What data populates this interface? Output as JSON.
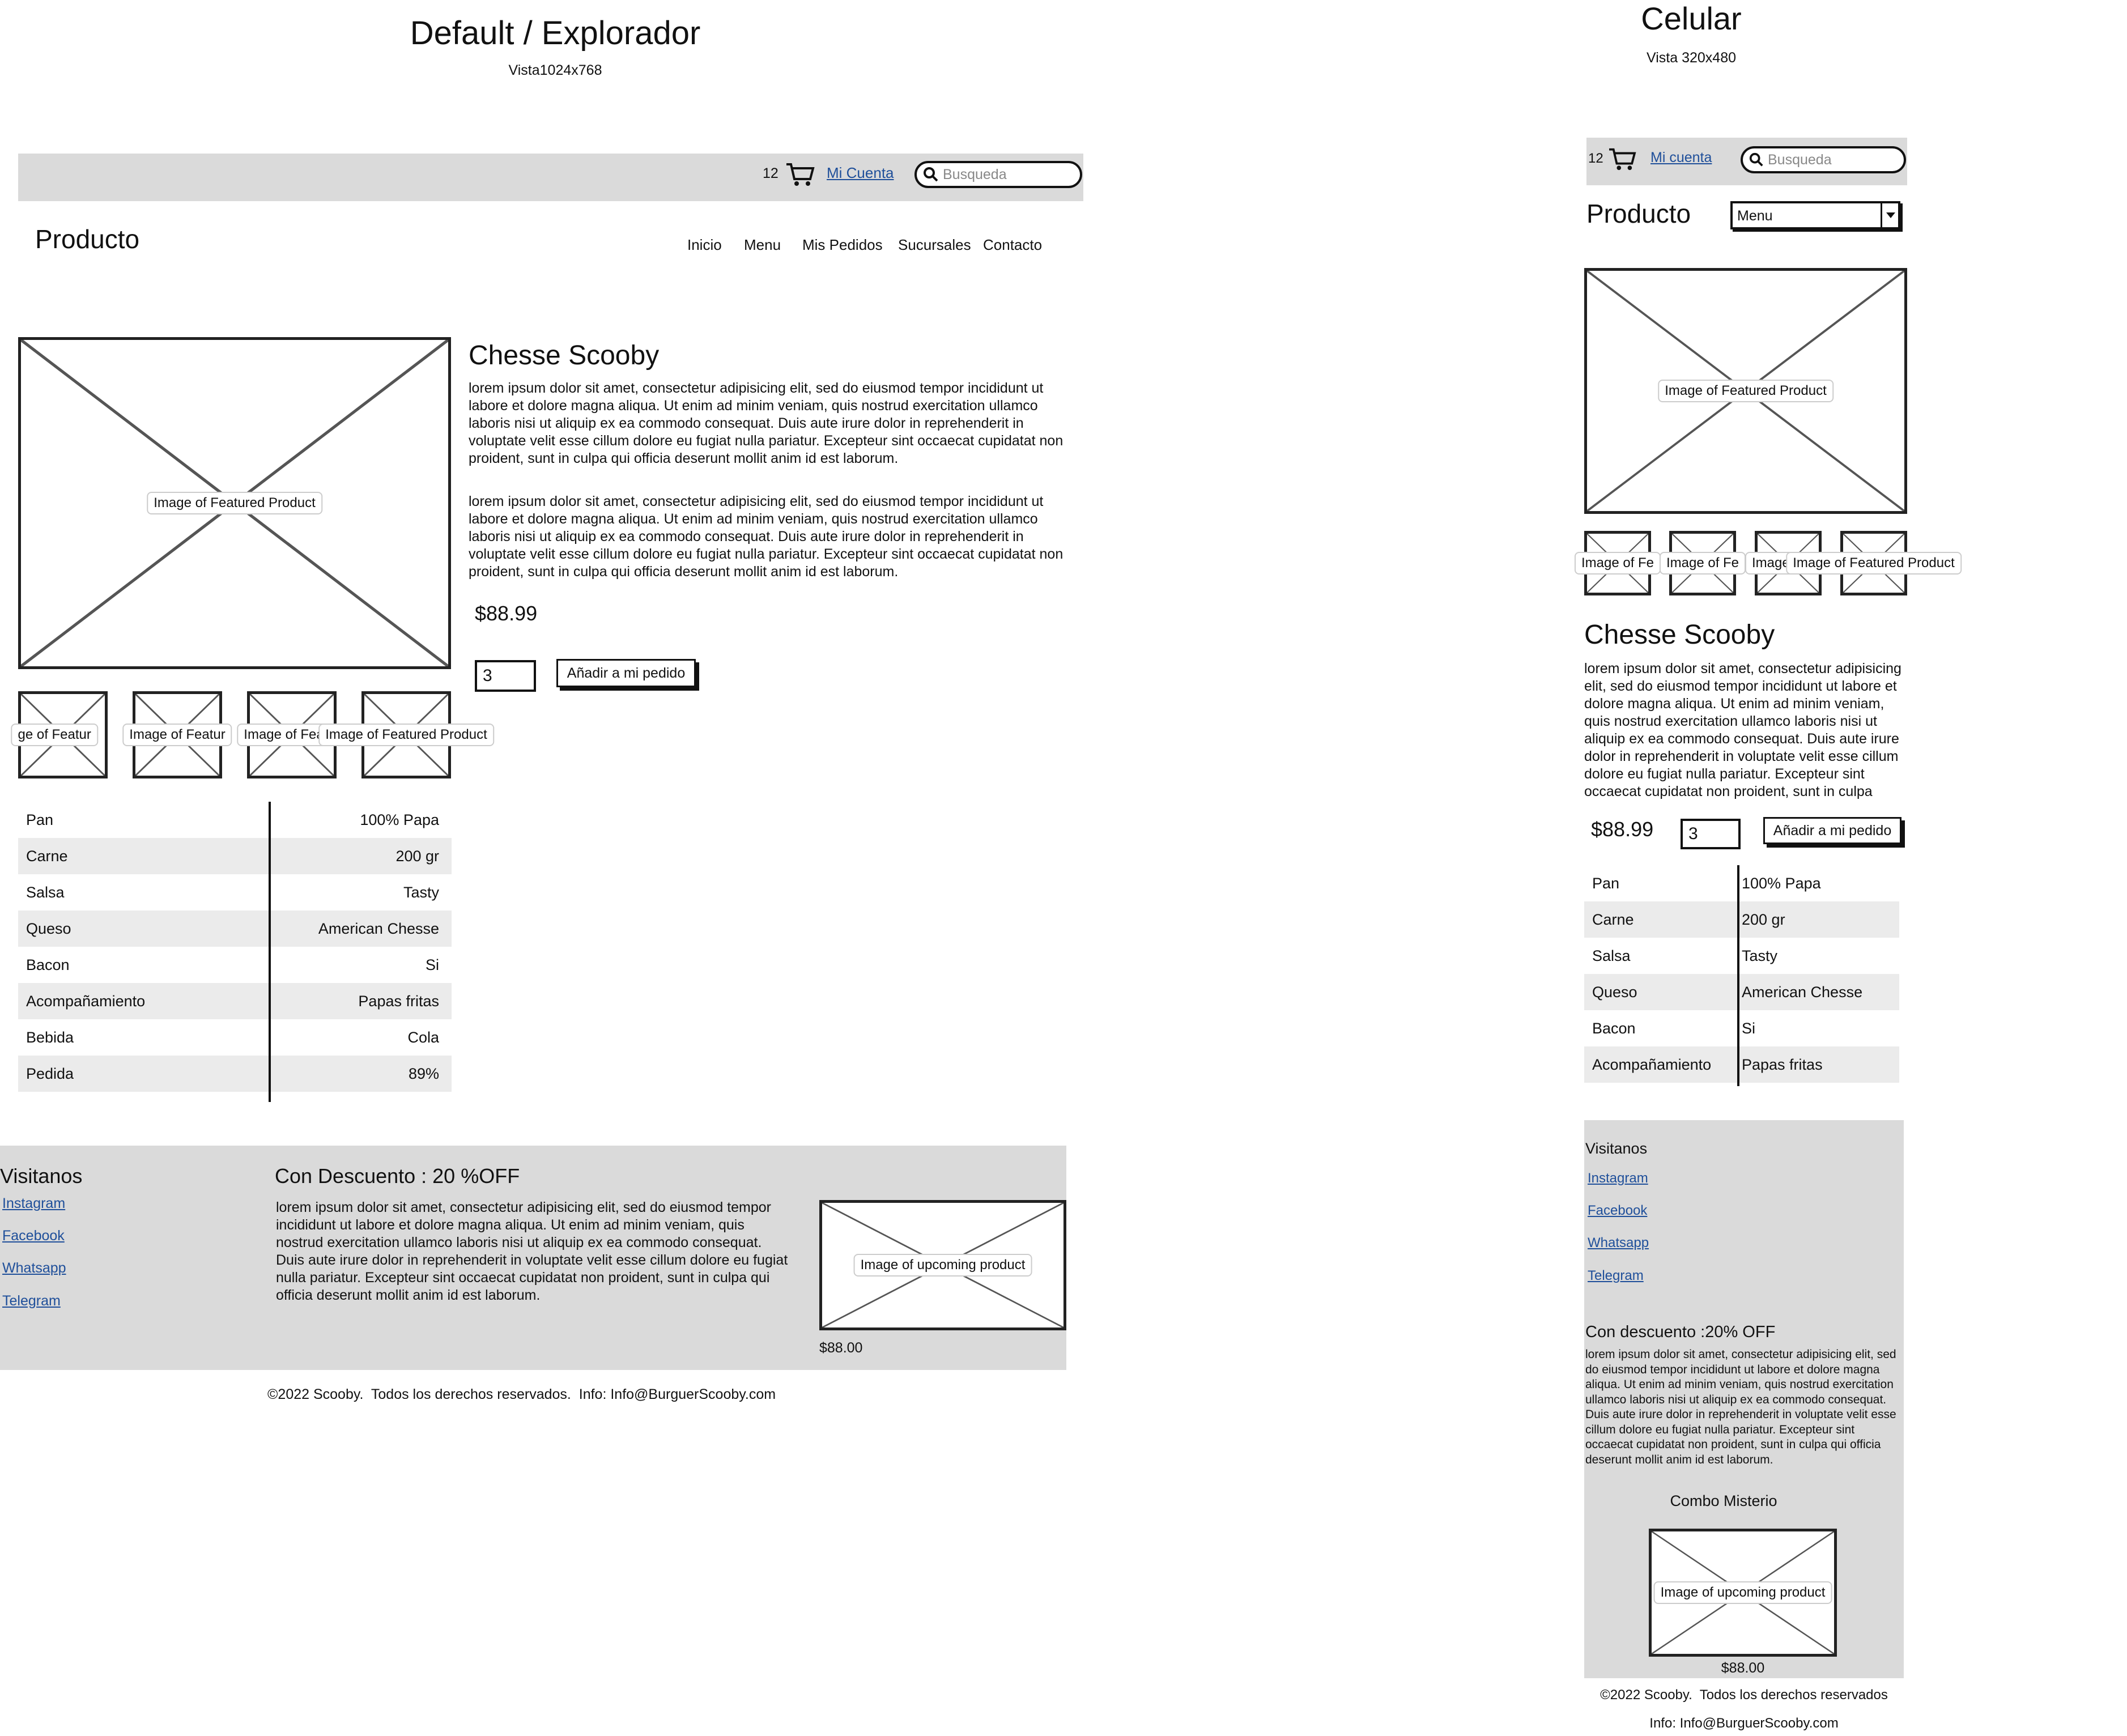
{
  "desktop": {
    "heading": "Default / Explorador",
    "subheading": "Vista1024x768",
    "topbar": {
      "cart_count": "12",
      "account": "Mi Cuenta",
      "search_placeholder": "Busqueda"
    },
    "page_title": "Producto",
    "nav": [
      "Inicio",
      "Menu",
      "Mis Pedidos",
      "Sucursales",
      "Contacto"
    ],
    "product": {
      "image_label": "Image of Featured Product",
      "thumb_labels": [
        "ge of Featur",
        "Image of Featur",
        "Image of Featur",
        "Image of Featured Product"
      ],
      "name": "Chesse Scooby",
      "desc1": "lorem ipsum dolor sit amet, consectetur adipisicing elit, sed do eiusmod tempor incididunt ut labore et dolore magna aliqua. Ut enim ad minim veniam, quis nostrud exercitation ullamco laboris nisi ut aliquip ex ea commodo consequat. Duis aute irure dolor in reprehenderit in voluptate velit esse cillum dolore eu fugiat nulla pariatur. Excepteur sint occaecat cupidatat non proident, sunt in culpa qui officia deserunt mollit anim id est laborum.",
      "desc2": "lorem ipsum dolor sit amet, consectetur adipisicing elit, sed do eiusmod tempor incididunt ut labore et dolore magna aliqua. Ut enim ad minim veniam, quis nostrud exercitation ullamco laboris nisi ut aliquip ex ea commodo consequat. Duis aute irure dolor in reprehenderit in voluptate velit esse cillum dolore eu fugiat nulla pariatur. Excepteur sint occaecat cupidatat non proident, sunt in culpa qui officia deserunt mollit anim id est laborum.",
      "price": "$88.99",
      "qty": "3",
      "add_button": "Añadir a mi pedido"
    },
    "specs": [
      {
        "k": "Pan",
        "v": "100% Papa"
      },
      {
        "k": "Carne",
        "v": "200 gr"
      },
      {
        "k": "Salsa",
        "v": "Tasty"
      },
      {
        "k": "Queso",
        "v": "American Chesse"
      },
      {
        "k": "Bacon",
        "v": "Si"
      },
      {
        "k": "Acompañamiento",
        "v": "Papas fritas"
      },
      {
        "k": "Bebida",
        "v": "Cola"
      },
      {
        "k": "Pedida",
        "v": "89%"
      }
    ],
    "footer": {
      "visit_title": "Visitanos",
      "links": [
        "Instagram",
        "Facebook",
        "Whatsapp",
        "Telegram"
      ],
      "promo_title": "Con Descuento : 20 %OFF",
      "promo_text": "lorem ipsum dolor sit amet, consectetur adipisicing elit, sed do eiusmod tempor incididunt ut labore et dolore magna aliqua. Ut enim ad minim veniam, quis nostrud exercitation ullamco laboris nisi ut aliquip ex ea commodo consequat. Duis aute irure dolor in reprehenderit in voluptate velit esse cillum dolore eu fugiat nulla pariatur. Excepteur sint occaecat cupidatat non proident, sunt in culpa qui officia deserunt mollit anim id est laborum.",
      "upcoming_label": "Image of upcoming product",
      "upcoming_price": "$88.00",
      "copyright": "©2022 Scooby.  Todos los derechos reservados.  Info: Info@BurguerScooby.com"
    }
  },
  "mobile": {
    "heading": "Celular",
    "subheading": "Vista 320x480",
    "topbar": {
      "cart_count": "12",
      "account": "Mi cuenta",
      "search_placeholder": "Busqueda"
    },
    "page_title": "Producto",
    "menu_select": "Menu",
    "product": {
      "image_label": "Image of Featured Product",
      "thumb_labels": [
        "Image of Fe",
        "Image of Fe",
        "Image of Fe",
        "Image of Featured Product"
      ],
      "name": "Chesse Scooby",
      "desc": "lorem ipsum dolor sit amet, consectetur adipisicing elit, sed do eiusmod tempor incididunt ut labore et dolore magna aliqua. Ut enim ad minim veniam, quis nostrud exercitation ullamco laboris nisi ut aliquip ex ea commodo consequat. Duis aute irure dolor in reprehenderit in voluptate velit esse cillum dolore eu fugiat nulla pariatur. Excepteur sint occaecat cupidatat non proident, sunt in culpa",
      "price": "$88.99",
      "qty": "3",
      "add_button": "Añadir a mi pedido"
    },
    "specs": [
      {
        "k": "Pan",
        "v": "100% Papa"
      },
      {
        "k": "Carne",
        "v": "200 gr"
      },
      {
        "k": "Salsa",
        "v": "Tasty"
      },
      {
        "k": "Queso",
        "v": "American Chesse"
      },
      {
        "k": "Bacon",
        "v": "Si"
      },
      {
        "k": "Acompañamiento",
        "v": "Papas fritas"
      }
    ],
    "footer": {
      "visit_title": "Visitanos",
      "links": [
        "Instagram",
        "Facebook",
        "Whatsapp",
        "Telegram"
      ],
      "promo_title": "Con descuento :20% OFF",
      "promo_text": "lorem ipsum dolor sit amet, consectetur adipisicing elit, sed do eiusmod tempor incididunt ut labore et dolore magna aliqua. Ut enim ad minim veniam, quis nostrud exercitation ullamco laboris nisi ut aliquip ex ea commodo consequat. Duis aute irure dolor in reprehenderit in voluptate velit esse cillum dolore eu fugiat nulla pariatur. Excepteur sint occaecat cupidatat non proident, sunt in culpa qui officia deserunt mollit anim id est laborum.",
      "combo_title": "Combo Misterio",
      "upcoming_label": "Image of upcoming product",
      "upcoming_price": "$88.00",
      "copyright1": "©2022 Scooby.  Todos los derechos reservados",
      "copyright2": "Info: Info@BurguerScooby.com"
    }
  }
}
